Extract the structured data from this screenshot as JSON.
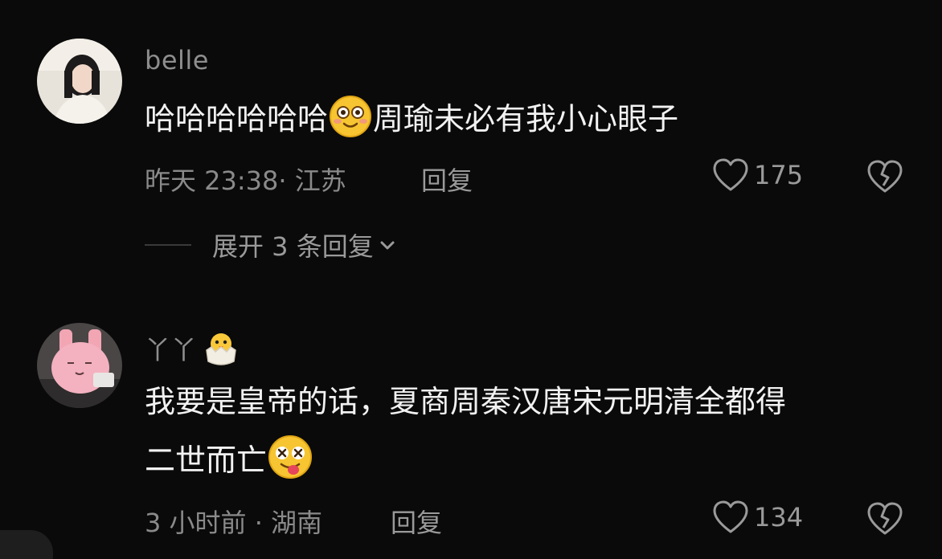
{
  "comments": [
    {
      "username": "belle",
      "text_before_emoji": "哈哈哈哈哈哈",
      "emoji": "smiling-face-emoji",
      "text_after_emoji": "周瑜未必有我小心眼子",
      "meta": "昨天 23:38· 江苏",
      "reply_label": "回复",
      "likes": "175",
      "expand_label": "展开 3 条回复"
    },
    {
      "username": "丫丫",
      "username_emoji": "hatching-chick-emoji",
      "text_line1": "我要是皇帝的话，夏商周秦汉唐宋元明清全都得",
      "text_line2": "二世而亡",
      "emoji": "dizzy-face-tongue-emoji",
      "meta": "3 小时前 · 湖南",
      "reply_label": "回复",
      "likes": "134"
    }
  ],
  "colors": {
    "background": "#0a0a0a",
    "text": "#f2f2f2",
    "muted": "#8a8a8a"
  }
}
